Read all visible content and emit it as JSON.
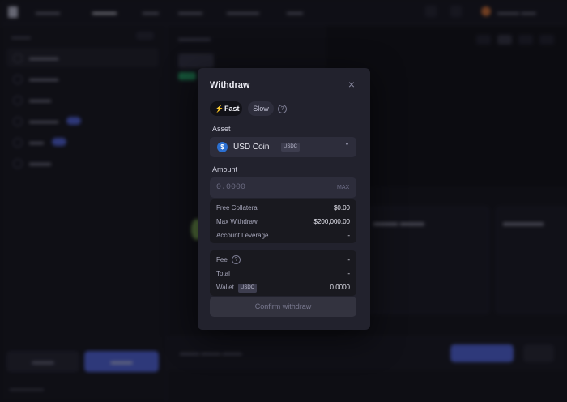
{
  "modal": {
    "title": "Withdraw",
    "speed_fast": "Fast",
    "speed_slow": "Slow",
    "asset_label": "Asset",
    "asset_name": "USD Coin",
    "asset_ticker": "USDC",
    "amount_label": "Amount",
    "amount_placeholder": "0.0000",
    "max_label": "MAX",
    "details": [
      {
        "key": "Free Collateral",
        "value": "$0.00"
      },
      {
        "key": "Max Withdraw",
        "value": "$200,000.00"
      },
      {
        "key": "Account Leverage",
        "value": "-"
      }
    ],
    "fees": {
      "fee_label": "Fee",
      "fee_value": "-",
      "total_label": "Total",
      "total_value": "-",
      "wallet_label": "Wallet",
      "wallet_ticker": "USDC",
      "wallet_value": "0.0000"
    },
    "confirm_label": "Confirm withdraw"
  },
  "colors": {
    "accent": "#5b71f5",
    "modal_bg": "#22222d",
    "bolt": "#f5c13d"
  },
  "icons": {
    "close": "close-icon",
    "bolt": "lightning-icon",
    "help": "question-circle-icon",
    "chevron": "chevron-down-icon",
    "coin": "usdc-coin-icon"
  }
}
